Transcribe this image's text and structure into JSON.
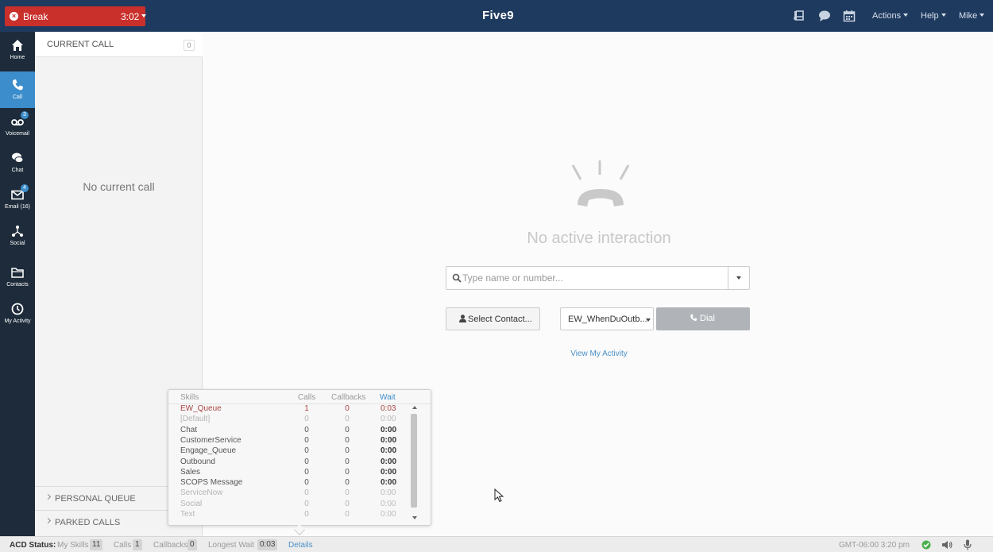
{
  "topbar": {
    "break_label": "Break",
    "break_timer": "3:02",
    "logo": "Five9",
    "menus": [
      {
        "label": "Actions"
      },
      {
        "label": "Help"
      },
      {
        "label": "Mike"
      }
    ],
    "icons": [
      "book-icon",
      "chat-bubble-icon",
      "calendar-icon"
    ]
  },
  "nav": {
    "items": [
      {
        "label": "Home",
        "icon": "home-icon",
        "badge": ""
      },
      {
        "label": "Call",
        "icon": "phone-icon",
        "badge": "",
        "active": true
      },
      {
        "label": "Voicemail",
        "icon": "voicemail-icon",
        "badge": "3"
      },
      {
        "label": "Chat",
        "icon": "chat-icon",
        "badge": ""
      },
      {
        "label": "Email (16)",
        "icon": "email-icon",
        "badge": "4"
      },
      {
        "label": "Social",
        "icon": "social-icon",
        "badge": ""
      },
      {
        "label": "Contacts",
        "icon": "folder-icon",
        "badge": ""
      },
      {
        "label": "My Activity",
        "icon": "clock-icon",
        "badge": ""
      }
    ]
  },
  "call_panel": {
    "title": "CURRENT CALL",
    "count": "0",
    "empty_text": "No current call",
    "sections": [
      {
        "label": "PERSONAL QUEUE"
      },
      {
        "label": "PARKED CALLS"
      }
    ]
  },
  "main": {
    "empty_title": "No active interaction",
    "search_placeholder": "Type name or number...",
    "select_contact_label": "Select Contact...",
    "skill_selected": "EW_WhenDuOutb...",
    "dial_label": "Dial",
    "view_activity_label": "View My Activity"
  },
  "skills": {
    "headers": {
      "skill": "Skills",
      "calls": "Calls",
      "callbacks": "Callbacks",
      "wait": "Wait"
    },
    "rows": [
      {
        "name": "EW_Queue",
        "calls": "1",
        "callbacks": "0",
        "wait": "0:03",
        "style": "hot"
      },
      {
        "name": "[Default]",
        "calls": "0",
        "callbacks": "0",
        "wait": "0:00",
        "style": "dim"
      },
      {
        "name": "Chat",
        "calls": "0",
        "callbacks": "0",
        "wait": "0:00",
        "style": "norm"
      },
      {
        "name": "CustomerService",
        "calls": "0",
        "callbacks": "0",
        "wait": "0:00",
        "style": "norm"
      },
      {
        "name": "Engage_Queue",
        "calls": "0",
        "callbacks": "0",
        "wait": "0:00",
        "style": "norm"
      },
      {
        "name": "Outbound",
        "calls": "0",
        "callbacks": "0",
        "wait": "0:00",
        "style": "norm"
      },
      {
        "name": "Sales",
        "calls": "0",
        "callbacks": "0",
        "wait": "0:00",
        "style": "norm"
      },
      {
        "name": "SCOPS Message",
        "calls": "0",
        "callbacks": "0",
        "wait": "0:00",
        "style": "norm"
      },
      {
        "name": "ServiceNow",
        "calls": "0",
        "callbacks": "0",
        "wait": "0:00",
        "style": "dim"
      },
      {
        "name": "Social",
        "calls": "0",
        "callbacks": "0",
        "wait": "0:00",
        "style": "dim"
      },
      {
        "name": "Text",
        "calls": "0",
        "callbacks": "0",
        "wait": "0:00",
        "style": "dim"
      }
    ]
  },
  "status": {
    "acd_label": "ACD Status:",
    "my_skills_label": "My Skills",
    "my_skills_value": "11",
    "calls_label": "Calls",
    "calls_value": "1",
    "callbacks_label": "Callbacks",
    "callbacks_value": "0",
    "longest_wait_label": "Longest Wait",
    "longest_wait_value": "0:03",
    "details_label": "Details",
    "timezone": "GMT-06:00 3:20 pm"
  },
  "colors": {
    "topbar": "#1f3a5f",
    "break": "#c9302c",
    "nav_bg": "#1d2b3a",
    "nav_active": "#3c8dcb",
    "link": "#4a90c8"
  }
}
